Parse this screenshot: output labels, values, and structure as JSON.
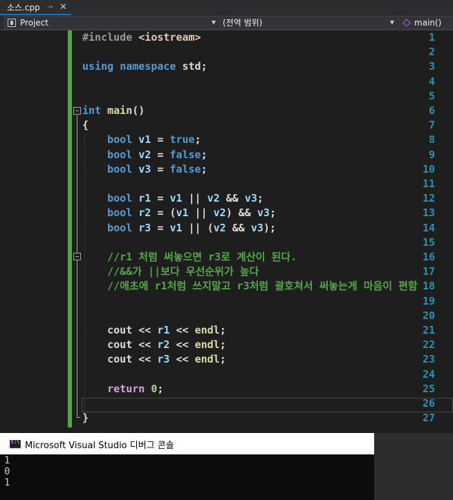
{
  "tab": {
    "title": "소스.cpp",
    "pin": "⊸",
    "close": "✕"
  },
  "navbar": {
    "project": "Project",
    "scope": "(전역 범위)",
    "member": "main()"
  },
  "editor": {
    "line_numbers": [
      "1",
      "2",
      "3",
      "4",
      "5",
      "6",
      "7",
      "8",
      "9",
      "10",
      "11",
      "12",
      "13",
      "14",
      "15",
      "16",
      "17",
      "18",
      "19",
      "20",
      "21",
      "22",
      "23",
      "24",
      "25",
      "26",
      "27"
    ],
    "lines": [
      [
        [
          "pre",
          "#include "
        ],
        [
          "str",
          "<iostream>"
        ]
      ],
      [],
      [
        [
          "kw",
          "using "
        ],
        [
          "kw",
          "namespace "
        ],
        [
          "plain",
          "std;"
        ]
      ],
      [],
      [],
      [
        [
          "kw",
          "int "
        ],
        [
          "fn",
          "main"
        ],
        [
          "plain",
          "()"
        ]
      ],
      [
        [
          "plain",
          "{"
        ]
      ],
      [
        [
          "plain",
          "    "
        ],
        [
          "kw",
          "bool "
        ],
        [
          "var",
          "v1"
        ],
        [
          "plain",
          " = "
        ],
        [
          "kw",
          "true"
        ],
        [
          "plain",
          ";"
        ]
      ],
      [
        [
          "plain",
          "    "
        ],
        [
          "kw",
          "bool "
        ],
        [
          "var",
          "v2"
        ],
        [
          "plain",
          " = "
        ],
        [
          "kw",
          "false"
        ],
        [
          "plain",
          ";"
        ]
      ],
      [
        [
          "plain",
          "    "
        ],
        [
          "kw",
          "bool "
        ],
        [
          "var",
          "v3"
        ],
        [
          "plain",
          " = "
        ],
        [
          "kw",
          "false"
        ],
        [
          "plain",
          ";"
        ]
      ],
      [],
      [
        [
          "plain",
          "    "
        ],
        [
          "kw",
          "bool "
        ],
        [
          "var",
          "r1"
        ],
        [
          "plain",
          " = "
        ],
        [
          "var",
          "v1"
        ],
        [
          "plain",
          " || "
        ],
        [
          "var",
          "v2"
        ],
        [
          "plain",
          " && "
        ],
        [
          "var",
          "v3"
        ],
        [
          "plain",
          ";"
        ]
      ],
      [
        [
          "plain",
          "    "
        ],
        [
          "kw",
          "bool "
        ],
        [
          "var",
          "r2"
        ],
        [
          "plain",
          " = ("
        ],
        [
          "var",
          "v1"
        ],
        [
          "plain",
          " || "
        ],
        [
          "var",
          "v2"
        ],
        [
          "plain",
          ") && "
        ],
        [
          "var",
          "v3"
        ],
        [
          "plain",
          ";"
        ]
      ],
      [
        [
          "plain",
          "    "
        ],
        [
          "kw",
          "bool "
        ],
        [
          "var",
          "r3"
        ],
        [
          "plain",
          " = "
        ],
        [
          "var",
          "v1"
        ],
        [
          "plain",
          " || ("
        ],
        [
          "var",
          "v2"
        ],
        [
          "plain",
          " && "
        ],
        [
          "var",
          "v3"
        ],
        [
          "plain",
          ");"
        ]
      ],
      [],
      [
        [
          "plain",
          "    "
        ],
        [
          "cmt",
          "//r1 처럼 써놓으면 r3로 계산이 된다."
        ]
      ],
      [
        [
          "plain",
          "    "
        ],
        [
          "cmt",
          "//&&가 ||보다 우선순위가 높다"
        ]
      ],
      [
        [
          "plain",
          "    "
        ],
        [
          "cmt",
          "//애초에 r1처럼 쓰지말고 r3처럼 괄호쳐서 써놓는게 마음이 편함"
        ]
      ],
      [],
      [],
      [
        [
          "plain",
          "    cout << "
        ],
        [
          "var",
          "r1"
        ],
        [
          "plain",
          " << "
        ],
        [
          "fn",
          "endl"
        ],
        [
          "plain",
          ";"
        ]
      ],
      [
        [
          "plain",
          "    cout << "
        ],
        [
          "var",
          "r2"
        ],
        [
          "plain",
          " << "
        ],
        [
          "fn",
          "endl"
        ],
        [
          "plain",
          ";"
        ]
      ],
      [
        [
          "plain",
          "    cout << "
        ],
        [
          "var",
          "r3"
        ],
        [
          "plain",
          " << "
        ],
        [
          "fn",
          "endl"
        ],
        [
          "plain",
          ";"
        ]
      ],
      [],
      [
        [
          "plain",
          "    "
        ],
        [
          "ctl",
          "return "
        ],
        [
          "num",
          "0"
        ],
        [
          "plain",
          ";"
        ]
      ],
      [],
      [
        [
          "plain",
          "}"
        ]
      ]
    ]
  },
  "console": {
    "title": "Microsoft Visual Studio 디버그 콘솔",
    "output": [
      "1",
      "0",
      "1"
    ]
  },
  "colors": {
    "line_number": "#2b91af",
    "keyword": "#569cd6",
    "comment": "#57a64a",
    "variable": "#9cdcfe",
    "function": "#dcdcaa"
  }
}
